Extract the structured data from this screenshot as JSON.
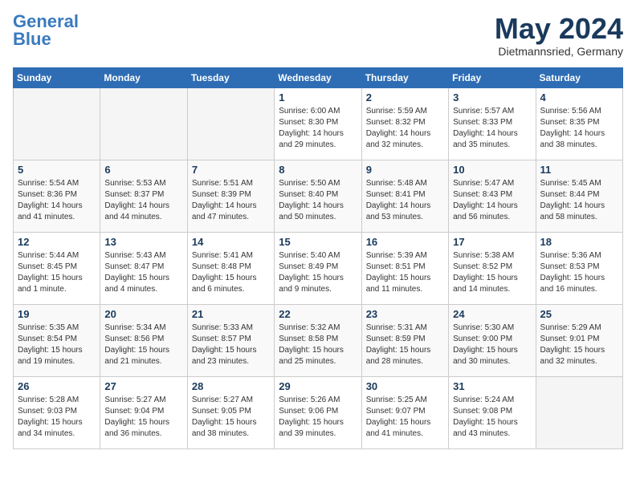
{
  "header": {
    "logo_general": "General",
    "logo_blue": "Blue",
    "month_year": "May 2024",
    "location": "Dietmannsried, Germany"
  },
  "days_of_week": [
    "Sunday",
    "Monday",
    "Tuesday",
    "Wednesday",
    "Thursday",
    "Friday",
    "Saturday"
  ],
  "weeks": [
    [
      {
        "day": "",
        "empty": true
      },
      {
        "day": "",
        "empty": true
      },
      {
        "day": "",
        "empty": true
      },
      {
        "day": "1",
        "sunrise": "6:00 AM",
        "sunset": "8:30 PM",
        "daylight": "14 hours and 29 minutes."
      },
      {
        "day": "2",
        "sunrise": "5:59 AM",
        "sunset": "8:32 PM",
        "daylight": "14 hours and 32 minutes."
      },
      {
        "day": "3",
        "sunrise": "5:57 AM",
        "sunset": "8:33 PM",
        "daylight": "14 hours and 35 minutes."
      },
      {
        "day": "4",
        "sunrise": "5:56 AM",
        "sunset": "8:35 PM",
        "daylight": "14 hours and 38 minutes."
      }
    ],
    [
      {
        "day": "5",
        "sunrise": "5:54 AM",
        "sunset": "8:36 PM",
        "daylight": "14 hours and 41 minutes."
      },
      {
        "day": "6",
        "sunrise": "5:53 AM",
        "sunset": "8:37 PM",
        "daylight": "14 hours and 44 minutes."
      },
      {
        "day": "7",
        "sunrise": "5:51 AM",
        "sunset": "8:39 PM",
        "daylight": "14 hours and 47 minutes."
      },
      {
        "day": "8",
        "sunrise": "5:50 AM",
        "sunset": "8:40 PM",
        "daylight": "14 hours and 50 minutes."
      },
      {
        "day": "9",
        "sunrise": "5:48 AM",
        "sunset": "8:41 PM",
        "daylight": "14 hours and 53 minutes."
      },
      {
        "day": "10",
        "sunrise": "5:47 AM",
        "sunset": "8:43 PM",
        "daylight": "14 hours and 56 minutes."
      },
      {
        "day": "11",
        "sunrise": "5:45 AM",
        "sunset": "8:44 PM",
        "daylight": "14 hours and 58 minutes."
      }
    ],
    [
      {
        "day": "12",
        "sunrise": "5:44 AM",
        "sunset": "8:45 PM",
        "daylight": "15 hours and 1 minute."
      },
      {
        "day": "13",
        "sunrise": "5:43 AM",
        "sunset": "8:47 PM",
        "daylight": "15 hours and 4 minutes."
      },
      {
        "day": "14",
        "sunrise": "5:41 AM",
        "sunset": "8:48 PM",
        "daylight": "15 hours and 6 minutes."
      },
      {
        "day": "15",
        "sunrise": "5:40 AM",
        "sunset": "8:49 PM",
        "daylight": "15 hours and 9 minutes."
      },
      {
        "day": "16",
        "sunrise": "5:39 AM",
        "sunset": "8:51 PM",
        "daylight": "15 hours and 11 minutes."
      },
      {
        "day": "17",
        "sunrise": "5:38 AM",
        "sunset": "8:52 PM",
        "daylight": "15 hours and 14 minutes."
      },
      {
        "day": "18",
        "sunrise": "5:36 AM",
        "sunset": "8:53 PM",
        "daylight": "15 hours and 16 minutes."
      }
    ],
    [
      {
        "day": "19",
        "sunrise": "5:35 AM",
        "sunset": "8:54 PM",
        "daylight": "15 hours and 19 minutes."
      },
      {
        "day": "20",
        "sunrise": "5:34 AM",
        "sunset": "8:56 PM",
        "daylight": "15 hours and 21 minutes."
      },
      {
        "day": "21",
        "sunrise": "5:33 AM",
        "sunset": "8:57 PM",
        "daylight": "15 hours and 23 minutes."
      },
      {
        "day": "22",
        "sunrise": "5:32 AM",
        "sunset": "8:58 PM",
        "daylight": "15 hours and 25 minutes."
      },
      {
        "day": "23",
        "sunrise": "5:31 AM",
        "sunset": "8:59 PM",
        "daylight": "15 hours and 28 minutes."
      },
      {
        "day": "24",
        "sunrise": "5:30 AM",
        "sunset": "9:00 PM",
        "daylight": "15 hours and 30 minutes."
      },
      {
        "day": "25",
        "sunrise": "5:29 AM",
        "sunset": "9:01 PM",
        "daylight": "15 hours and 32 minutes."
      }
    ],
    [
      {
        "day": "26",
        "sunrise": "5:28 AM",
        "sunset": "9:03 PM",
        "daylight": "15 hours and 34 minutes."
      },
      {
        "day": "27",
        "sunrise": "5:27 AM",
        "sunset": "9:04 PM",
        "daylight": "15 hours and 36 minutes."
      },
      {
        "day": "28",
        "sunrise": "5:27 AM",
        "sunset": "9:05 PM",
        "daylight": "15 hours and 38 minutes."
      },
      {
        "day": "29",
        "sunrise": "5:26 AM",
        "sunset": "9:06 PM",
        "daylight": "15 hours and 39 minutes."
      },
      {
        "day": "30",
        "sunrise": "5:25 AM",
        "sunset": "9:07 PM",
        "daylight": "15 hours and 41 minutes."
      },
      {
        "day": "31",
        "sunrise": "5:24 AM",
        "sunset": "9:08 PM",
        "daylight": "15 hours and 43 minutes."
      },
      {
        "day": "",
        "empty": true
      }
    ]
  ]
}
